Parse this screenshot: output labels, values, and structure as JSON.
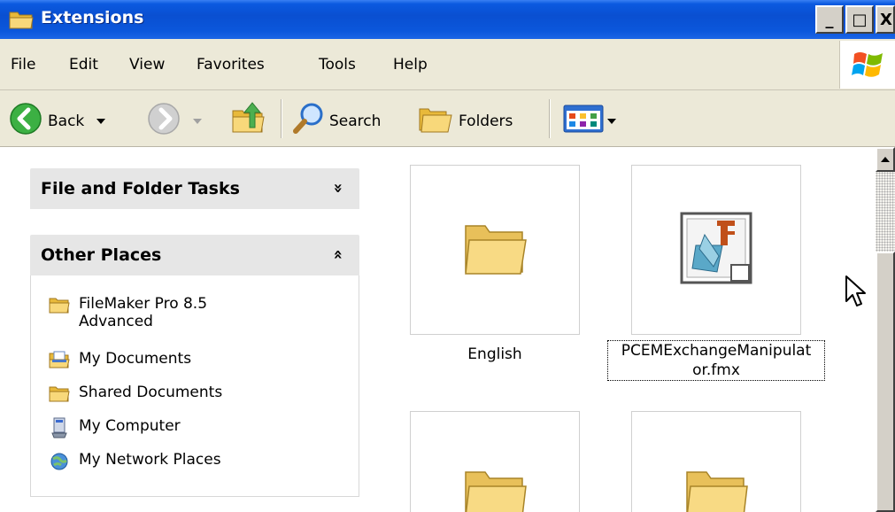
{
  "window": {
    "title": "Extensions",
    "title_icon": "folder-icon",
    "controls": {
      "minimize": "_",
      "maximize": "□",
      "close": "X"
    }
  },
  "menu": {
    "items": [
      "File",
      "Edit",
      "View",
      "Favorites",
      "Tools",
      "Help"
    ]
  },
  "toolbar": {
    "back_label": "Back",
    "search_label": "Search",
    "folders_label": "Folders"
  },
  "left_pane": {
    "file_folder_tasks": {
      "title": "File and Folder Tasks",
      "chevron": "»"
    },
    "other_places": {
      "title": "Other Places",
      "chevron": "«",
      "items": [
        {
          "label_line1": "FileMaker Pro 8.5",
          "label_line2": "Advanced",
          "icon": "folder-icon"
        },
        {
          "label_line1": "My Documents",
          "label_line2": "",
          "icon": "my-documents-icon"
        },
        {
          "label_line1": "Shared Documents",
          "label_line2": "",
          "icon": "folder-icon"
        },
        {
          "label_line1": "My Computer",
          "label_line2": "",
          "icon": "my-computer-icon"
        },
        {
          "label_line1": "My Network Places",
          "label_line2": "",
          "icon": "network-places-icon"
        }
      ]
    }
  },
  "files": [
    {
      "label": "English",
      "icon": "folder-icon",
      "selected": false
    },
    {
      "label_line1": "PCEMExchangeManipulat",
      "label_line2": "or.fmx",
      "icon": "plugin-file-icon",
      "selected": true
    },
    {
      "label": "",
      "icon": "folder-icon",
      "selected": false
    },
    {
      "label": "",
      "icon": "folder-icon",
      "selected": false
    }
  ],
  "colors": {
    "titlebar": "#0a4fd1",
    "menu_bg": "#ece9d8",
    "panel_header": "#e6e6e6",
    "folder_yellow": "#f6d67a"
  }
}
